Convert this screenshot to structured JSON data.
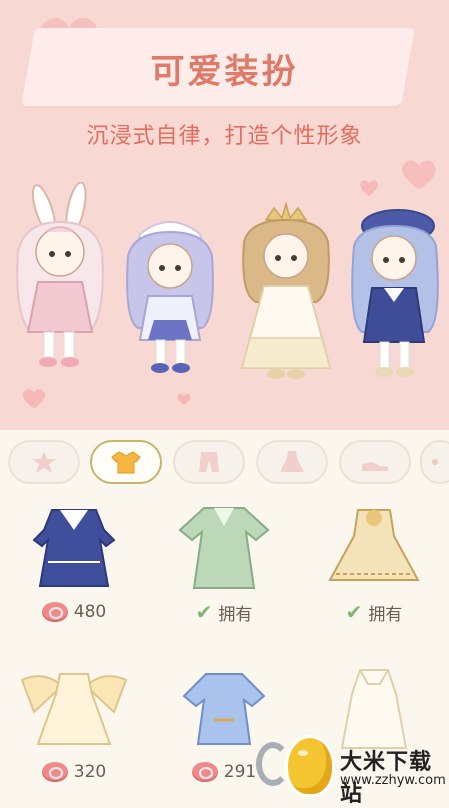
{
  "header": {
    "title": "可爱装扮",
    "subtitle": "沉浸式自律，打造个性形象"
  },
  "characters": [
    {
      "name": "bunny-ears-girl"
    },
    {
      "name": "lavender-bonnet-girl"
    },
    {
      "name": "golden-tiara-girl"
    },
    {
      "name": "blue-beret-girl"
    }
  ],
  "tabs": [
    {
      "icon": "star-icon",
      "active": false
    },
    {
      "icon": "top-clothing-icon",
      "active": true
    },
    {
      "icon": "pants-icon",
      "active": false
    },
    {
      "icon": "dress-icon",
      "active": false
    },
    {
      "icon": "shoe-icon",
      "active": false
    },
    {
      "icon": "more-icon",
      "active": false
    }
  ],
  "items": [
    {
      "outfit": "navy-sailor-dress",
      "price": "480",
      "owned": false
    },
    {
      "outfit": "green-hanfu-dress",
      "owned": true,
      "owned_label": "拥有"
    },
    {
      "outfit": "golden-flower-dress",
      "owned": true,
      "owned_label": "拥有"
    },
    {
      "outfit": "fairy-wing-dress",
      "price": "320",
      "owned": false
    },
    {
      "outfit": "blue-puff-dress",
      "price": "291",
      "owned": false
    },
    {
      "outfit": "white-gown",
      "owned": false
    }
  ],
  "watermark": {
    "text": "大米下载站",
    "url": "www.zzhyw.com"
  },
  "colors": {
    "hero_bg": "#f8d8d2",
    "title": "#e07a68",
    "subtitle": "#e36e5d",
    "page_bg": "#fbf6ee",
    "coin": "#ef8a8a",
    "check": "#7fb86e"
  }
}
